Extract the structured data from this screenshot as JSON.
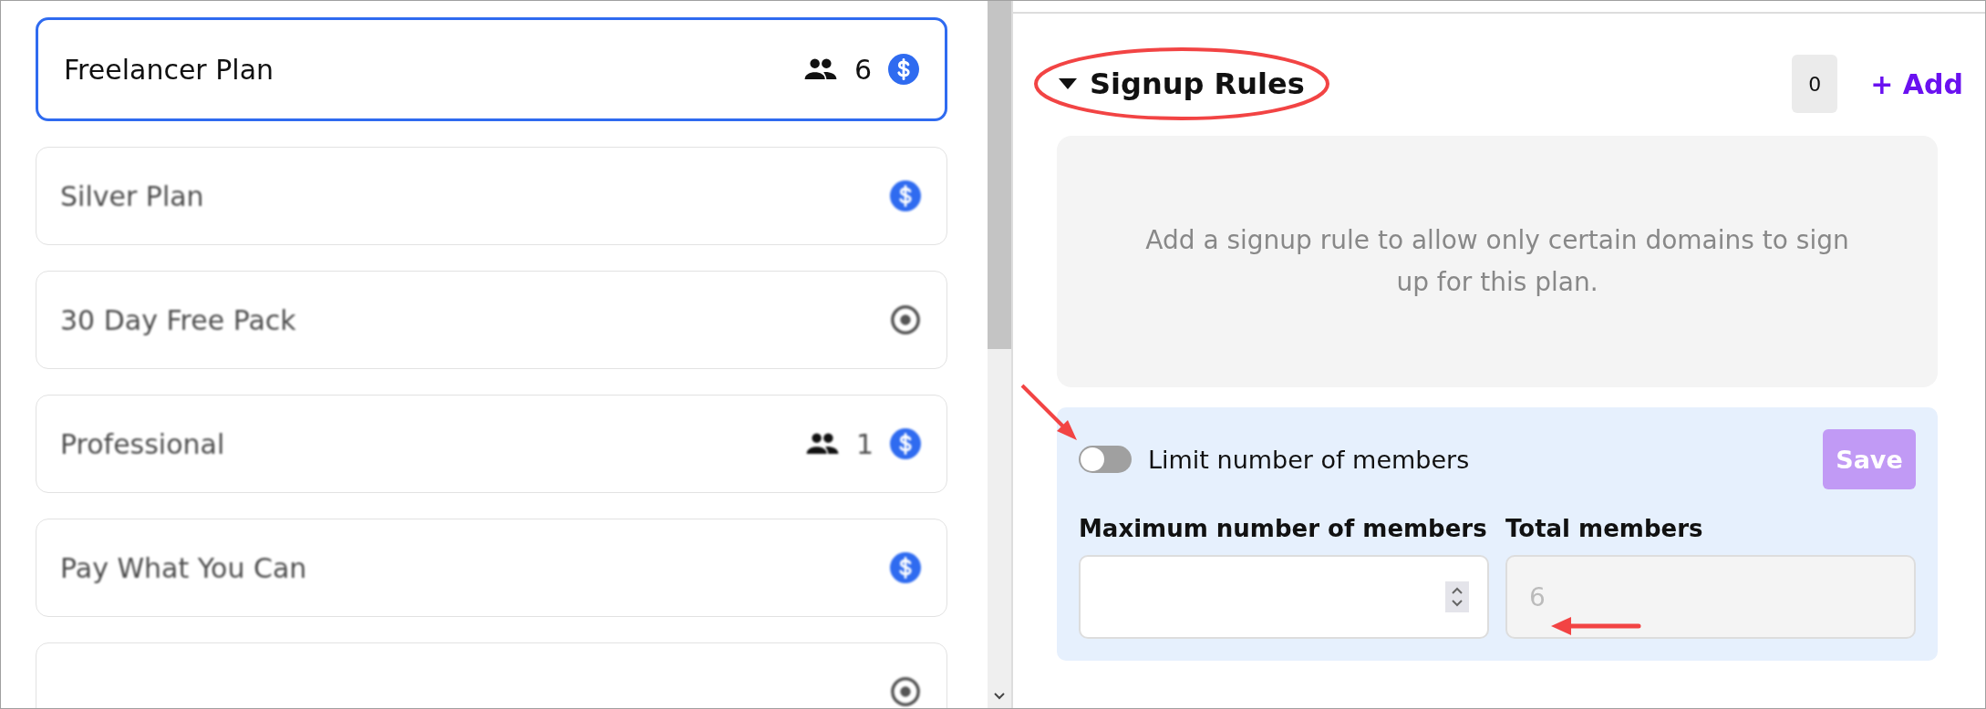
{
  "plans": [
    {
      "name": "Freelancer Plan",
      "members": "6",
      "kind": "paid",
      "selected": true
    },
    {
      "name": "Silver Plan",
      "kind": "paid",
      "selected": false
    },
    {
      "name": "30 Day Free Pack",
      "kind": "free",
      "selected": false
    },
    {
      "name": "Professional",
      "members": "1",
      "kind": "paid",
      "selected": false
    },
    {
      "name": "Pay What You Can",
      "kind": "paid",
      "selected": false
    },
    {
      "kind": "free",
      "selected": false
    }
  ],
  "signup_rules": {
    "title": "Signup Rules",
    "expanded": true,
    "count": "0",
    "add_label": "+ Add",
    "empty_message": "Add a signup rule to allow only certain domains to sign up for this plan."
  },
  "member_limit": {
    "toggle_label": "Limit number of members",
    "on": false,
    "save_label": "Save",
    "save_disabled": true,
    "max_field": {
      "label": "Maximum number of members"
    },
    "total_field": {
      "label": "Total members",
      "value": "6",
      "disabled": true
    }
  }
}
